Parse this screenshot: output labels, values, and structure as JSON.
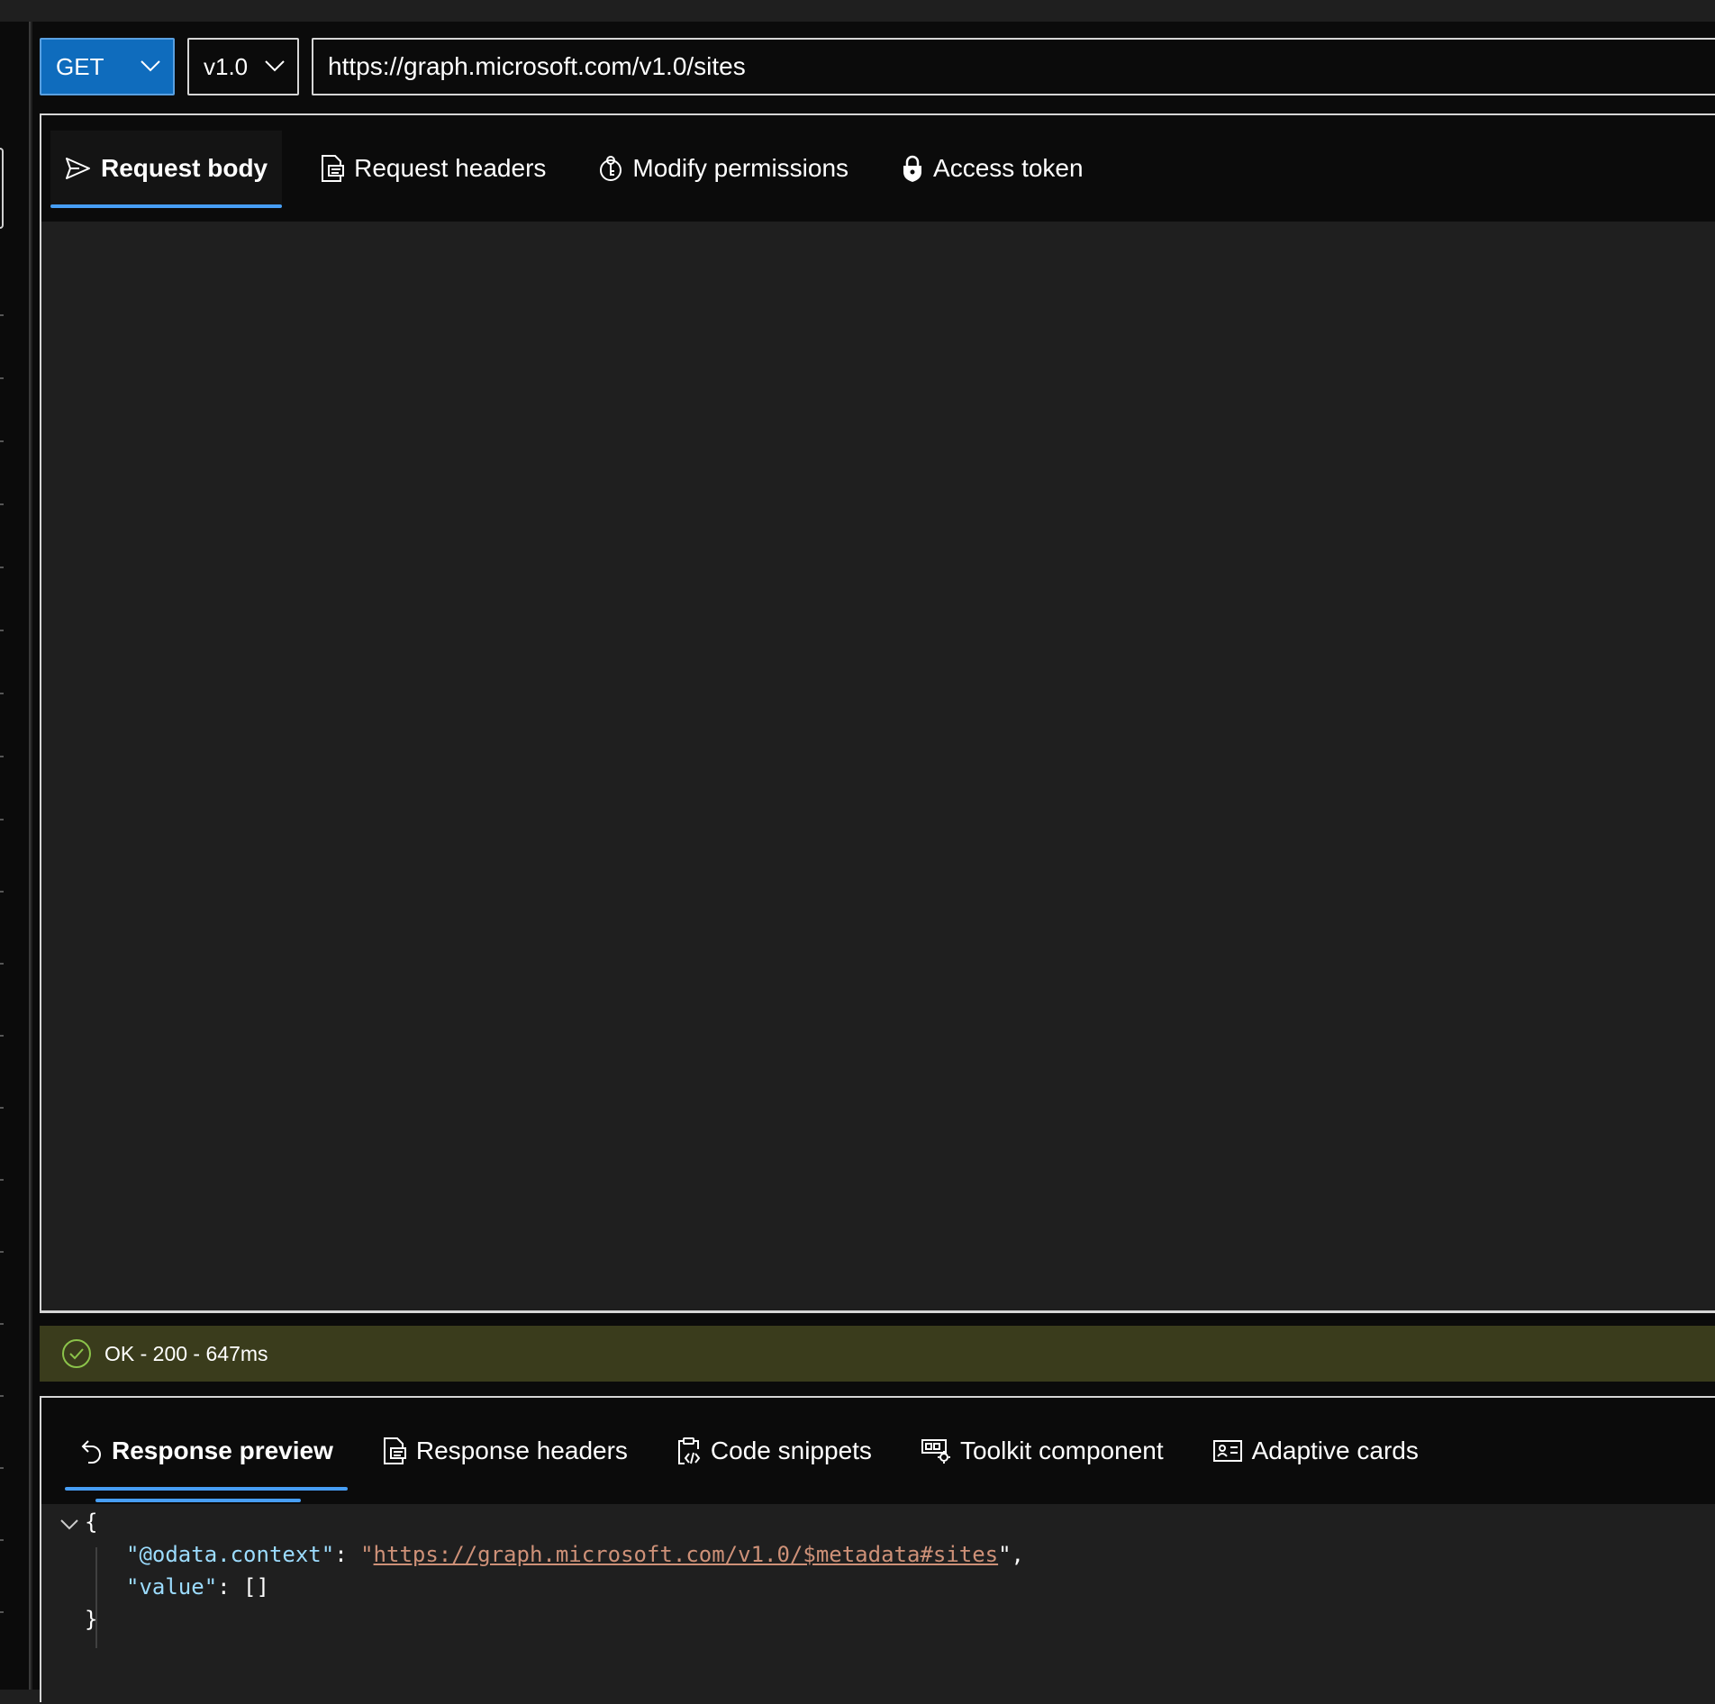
{
  "query": {
    "method": "GET",
    "version": "v1.0",
    "url": "https://graph.microsoft.com/v1.0/sites"
  },
  "request_tabs": [
    {
      "label": "Request body",
      "icon": "send-icon",
      "active": true
    },
    {
      "label": "Request headers",
      "icon": "document-list-icon",
      "active": false
    },
    {
      "label": "Modify permissions",
      "icon": "shield-key-icon",
      "active": false
    },
    {
      "label": "Access token",
      "icon": "lock-icon",
      "active": false
    }
  ],
  "status": {
    "text": "OK - 200 - 647ms",
    "icon": "checkmark-circle-icon",
    "color": "#8bc34a"
  },
  "response_tabs": [
    {
      "label": "Response preview",
      "icon": "undo-arrow-icon",
      "active": true
    },
    {
      "label": "Response headers",
      "icon": "document-list-icon",
      "active": false
    },
    {
      "label": "Code snippets",
      "icon": "clipboard-code-icon",
      "active": false
    },
    {
      "label": "Toolkit component",
      "icon": "toolkit-gear-icon",
      "active": false
    },
    {
      "label": "Adaptive cards",
      "icon": "contact-card-icon",
      "active": false
    }
  ],
  "response_json": {
    "open_brace": "{",
    "close_brace": "}",
    "context_key": "\"@odata.context\"",
    "context_sep": ": ",
    "context_quote_open": "\"",
    "context_value": "https://graph.microsoft.com/v1.0/$metadata#sites",
    "context_quote_close": "\",",
    "value_key": "\"value\"",
    "value_rest": ": []"
  },
  "colors": {
    "accent": "#0f6cbd",
    "tab_underline": "#479ef5",
    "status_bg": "#3a3c1c",
    "json_key": "#9cdcfe",
    "json_string": "#ce9178"
  }
}
